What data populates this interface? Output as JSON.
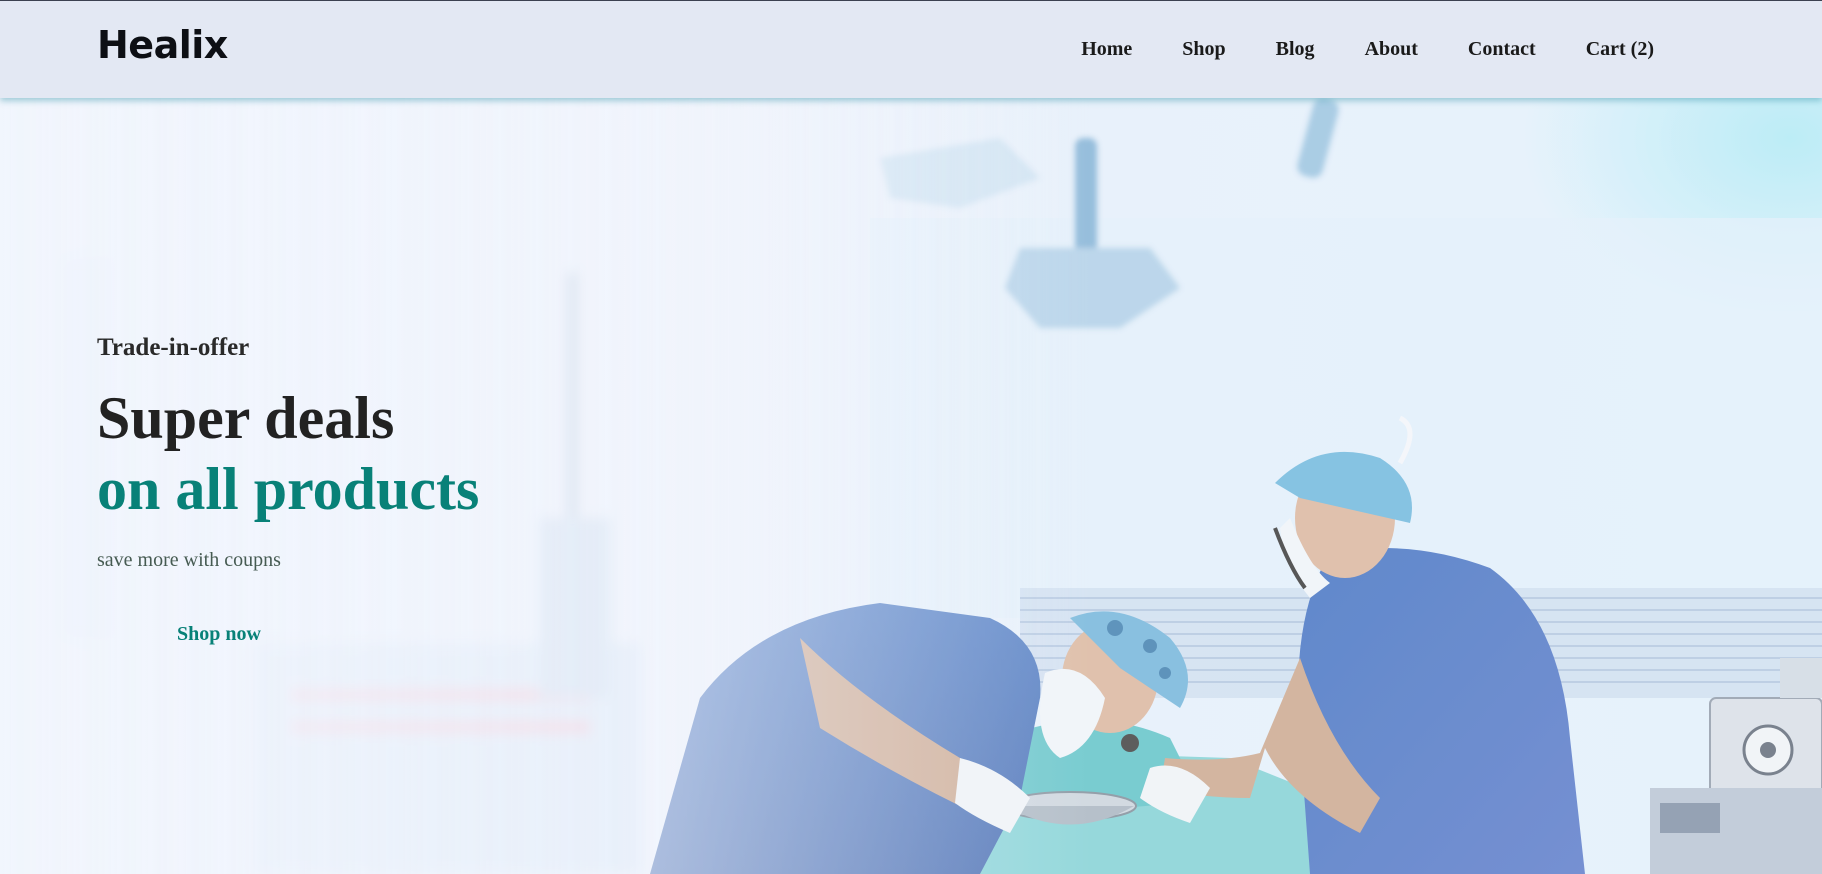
{
  "brand": {
    "name": "Healix"
  },
  "nav": {
    "items": [
      {
        "label": "Home"
      },
      {
        "label": "Shop"
      },
      {
        "label": "Blog"
      },
      {
        "label": "About"
      },
      {
        "label": "Contact"
      },
      {
        "label": "Cart (2)"
      }
    ]
  },
  "hero": {
    "kicker": "Trade-in-offer",
    "headline": "Super deals",
    "headline_accent": "on all products",
    "subtext": "save more with coupns",
    "cta_label": "Shop now",
    "background_image": "surgeons-operating-room-photo"
  },
  "colors": {
    "accent": "#088178",
    "header_bg": "#e3e8f3",
    "text_dark": "#222222",
    "scrub_blue": "#3f6fb8"
  }
}
